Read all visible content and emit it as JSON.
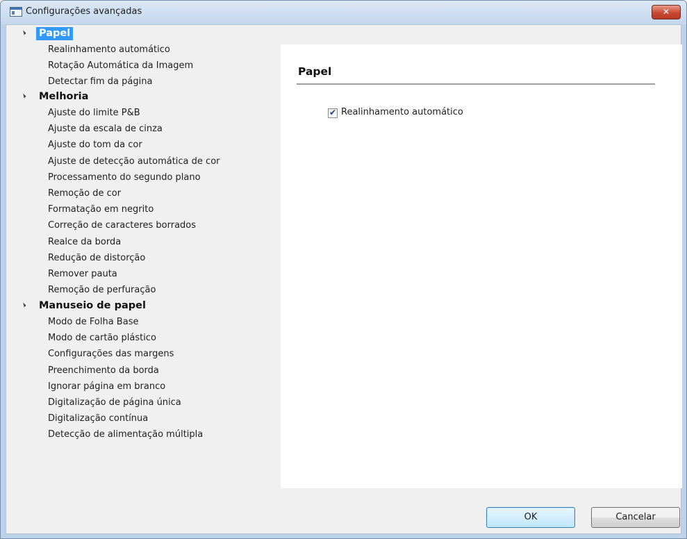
{
  "window": {
    "title": "Configurações avançadas",
    "close_symbol": "✕"
  },
  "tree": [
    {
      "label": "Papel",
      "selected": true,
      "items": [
        "Realinhamento automático",
        "Rotação Automática da Imagem",
        "Detectar fim da página"
      ]
    },
    {
      "label": "Melhoria",
      "selected": false,
      "items": [
        "Ajuste do limite P&B",
        "Ajuste da escala de cinza",
        "Ajuste do tom da cor",
        "Ajuste de detecção automática de cor",
        "Processamento do segundo plano",
        "Remoção de cor",
        "Formatação em negrito",
        "Correção de caracteres borrados",
        "Realce da borda",
        "Redução de distorção",
        "Remover pauta",
        "Remoção de perfuração"
      ]
    },
    {
      "label": "Manuseio de papel",
      "selected": false,
      "items": [
        "Modo de Folha Base",
        "Modo de cartão plástico",
        "Configurações das margens",
        "Preenchimento da borda",
        "Ignorar página em branco",
        "Digitalização de página única",
        "Digitalização contínua",
        "Detecção de alimentação múltipla"
      ]
    }
  ],
  "panel": {
    "title": "Papel",
    "checkbox_label": "Realinhamento automático",
    "checkbox_checked": true
  },
  "buttons": {
    "ok": "OK",
    "cancel": "Cancelar"
  }
}
